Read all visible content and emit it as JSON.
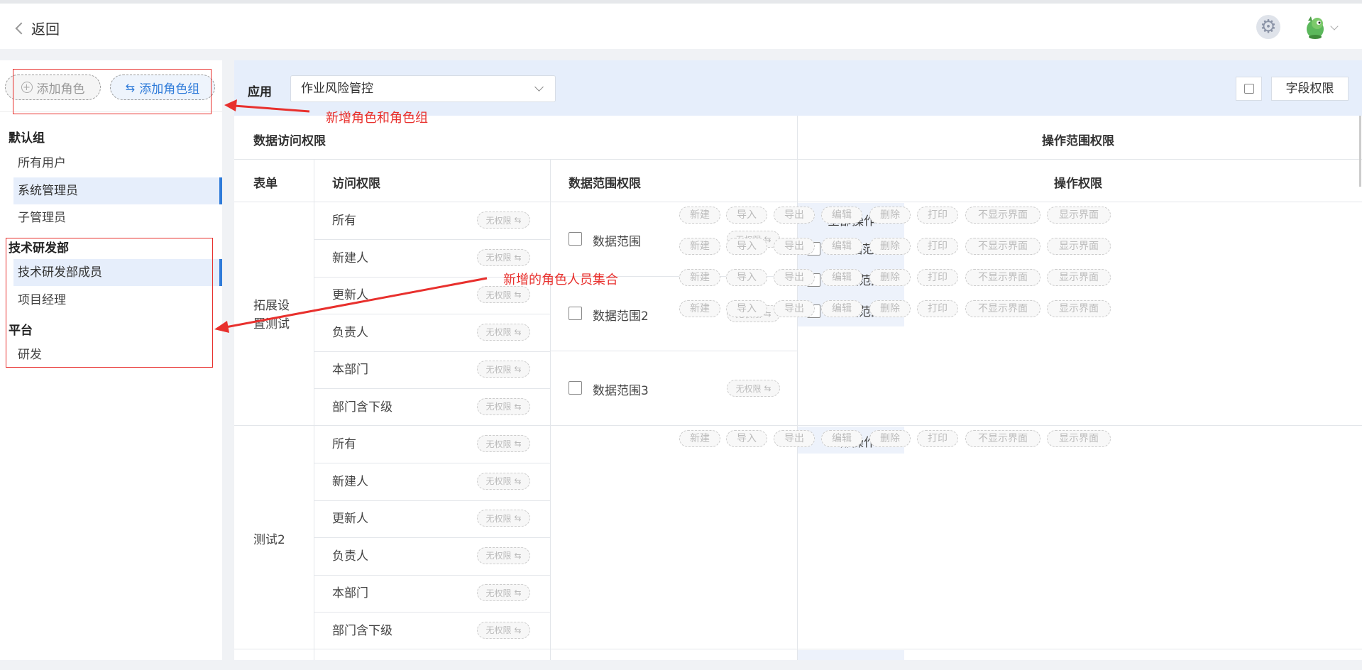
{
  "header": {
    "back_label": "返回"
  },
  "sidebar": {
    "add_role_label": "添加角色",
    "add_group_label": "添加角色组",
    "groups": [
      {
        "name": "默认组",
        "roles": [
          {
            "label": "所有用户"
          },
          {
            "label": "系统管理员",
            "active": true
          },
          {
            "label": "子管理员"
          }
        ]
      },
      {
        "name": "技术研发部",
        "roles": [
          {
            "label": "技术研发部成员",
            "active": true
          },
          {
            "label": "项目经理"
          }
        ]
      },
      {
        "name": "平台",
        "roles": [
          {
            "label": "研发"
          }
        ]
      }
    ]
  },
  "toolbar": {
    "app_label": "应用",
    "app_value": "作业风险管控",
    "field_perm_label": "字段权限"
  },
  "table": {
    "headers": {
      "data_access": "数据访问权限",
      "op_scope": "操作范围权限",
      "form": "表单",
      "access": "访问权限",
      "data_scope": "数据范围权限",
      "op_perm": "操作权限"
    },
    "access_options": [
      "所有",
      "新建人",
      "更新人",
      "负责人",
      "本部门",
      "部门含下级"
    ],
    "no_perm_label": "无权限",
    "ops": [
      "新建",
      "导入",
      "导出",
      "编辑",
      "删除",
      "打印",
      "不显示界面",
      "显示界面"
    ],
    "all_ops_label": "全部操作",
    "forms": [
      {
        "name": "拓展设置测试",
        "scopes": [
          "数据范围",
          "数据范围2",
          "数据范围3"
        ]
      },
      {
        "name": "测试2",
        "scopes": []
      }
    ]
  },
  "annotations": {
    "add_role_note": "新增角色和角色组",
    "role_set_note": "新增的角色人员集合"
  },
  "colors": {
    "accent": "#2f7bd9",
    "annotation": "#e8302d",
    "toolbar_bg": "#e6eefb"
  },
  "icons": {
    "gear": "gear-icon",
    "avatar": "avatar-icon",
    "save": "save-icon"
  }
}
